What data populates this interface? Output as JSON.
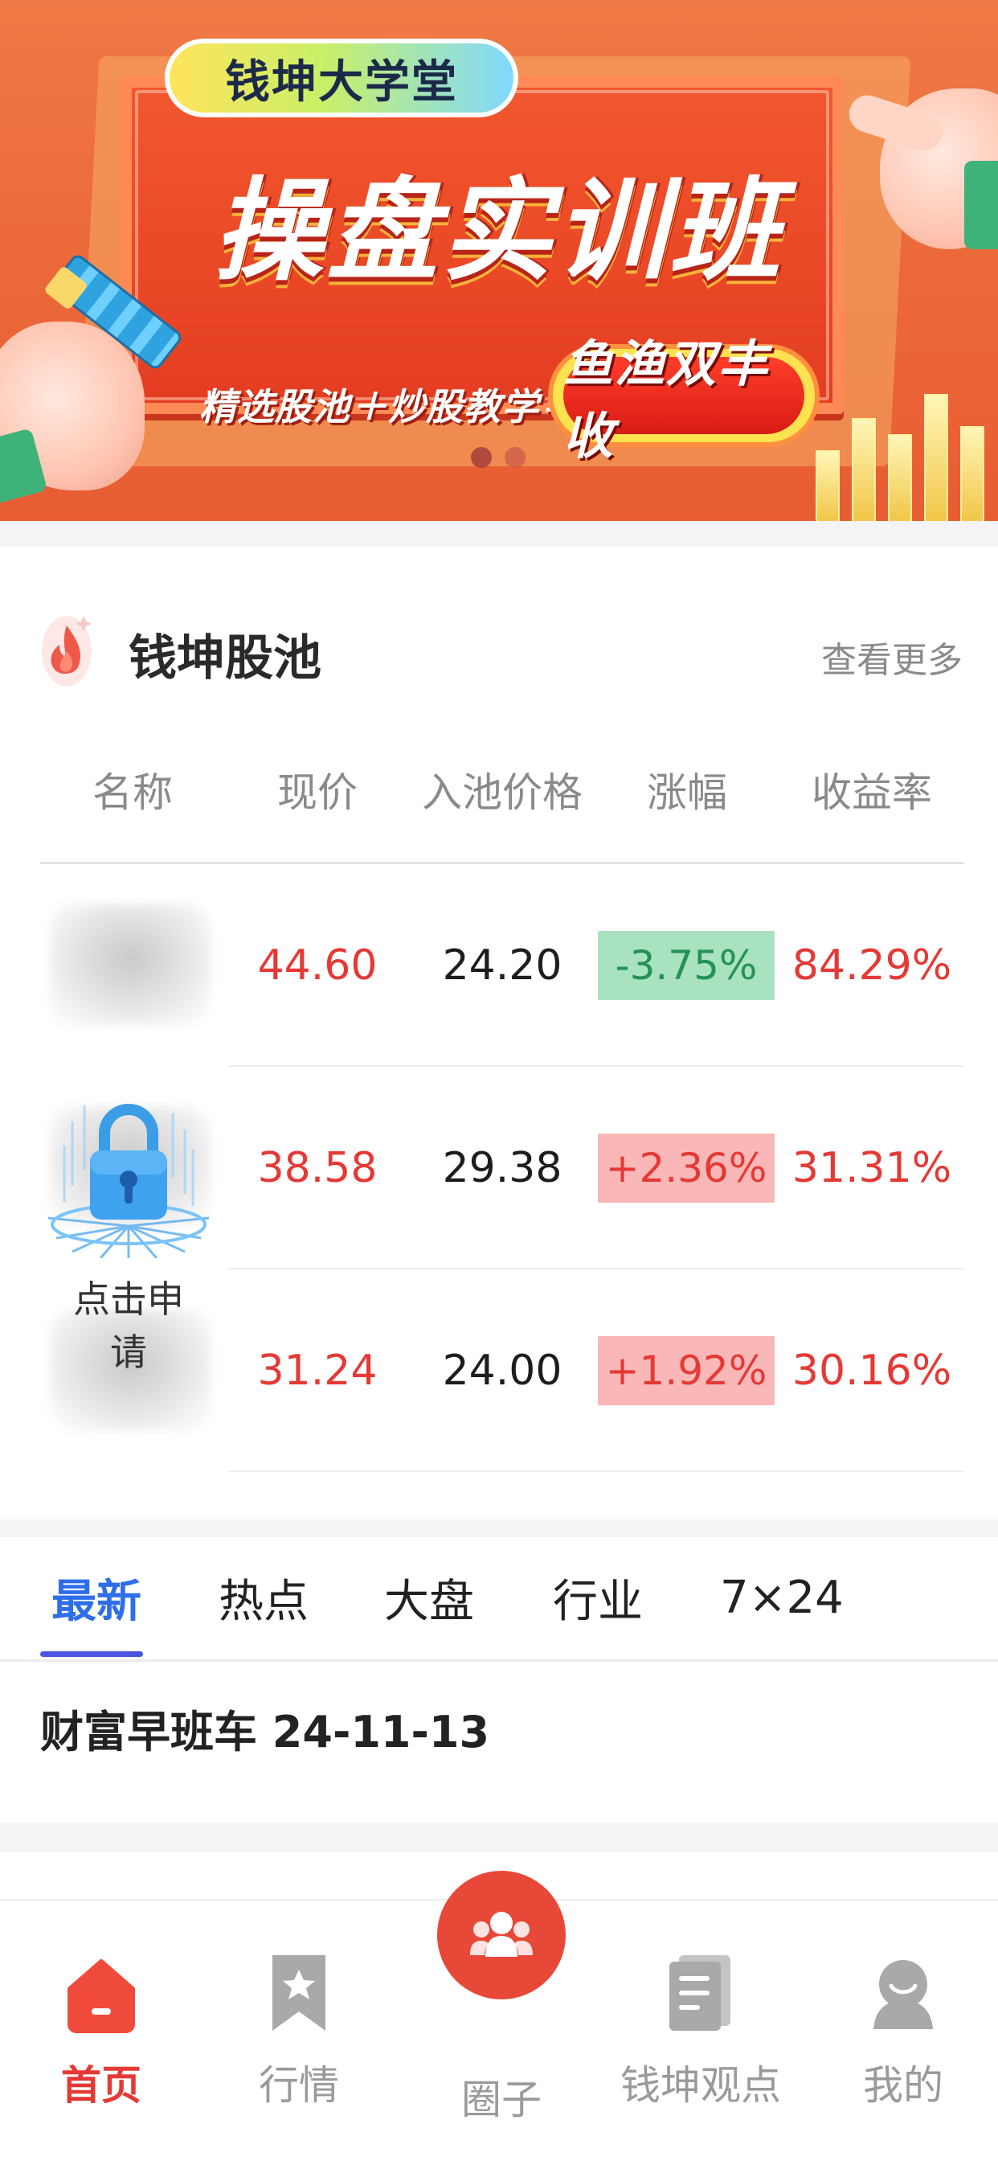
{
  "banner": {
    "college_label": "钱坤大学堂",
    "headline": "操盘实训班",
    "subline": "精选股池＋炒股教学＝",
    "highlight": "鱼渔双丰收",
    "carousel_pages": 2,
    "carousel_active": 1
  },
  "stock_pool": {
    "title": "钱坤股池",
    "view_more": "查看更多",
    "columns": [
      "名称",
      "现价",
      "入池价格",
      "涨幅",
      "收益率"
    ],
    "rows": [
      {
        "price": "44.60",
        "entry_price": "24.20",
        "change": "-3.75%",
        "direction": "down",
        "yield": "84.29%"
      },
      {
        "price": "38.58",
        "entry_price": "29.38",
        "change": "+2.36%",
        "direction": "up",
        "yield": "31.31%"
      },
      {
        "price": "31.24",
        "entry_price": "24.00",
        "change": "+1.92%",
        "direction": "up",
        "yield": "30.16%"
      }
    ],
    "apply_label": "点击申请"
  },
  "news": {
    "tabs": [
      "最新",
      "热点",
      "大盘",
      "行业",
      "7×24"
    ],
    "active_tab": 0,
    "articles": [
      {
        "title": "财富早班车 24-11-13"
      }
    ]
  },
  "bottom_nav": {
    "items": [
      {
        "label": "首页",
        "icon": "home-icon",
        "active": true
      },
      {
        "label": "行情",
        "icon": "bookmark-star-icon",
        "active": false
      },
      {
        "label": "圈子",
        "icon": "community-icon",
        "active": false
      },
      {
        "label": "钱坤观点",
        "icon": "document-icon",
        "active": false
      },
      {
        "label": "我的",
        "icon": "user-icon",
        "active": false
      }
    ]
  },
  "colors": {
    "accent_red": "#e53935",
    "tab_blue": "#2e6ee8",
    "down_green_bg": "#a9e2c0",
    "up_red_bg": "#f9b7b7",
    "center_button": "#e84838"
  }
}
